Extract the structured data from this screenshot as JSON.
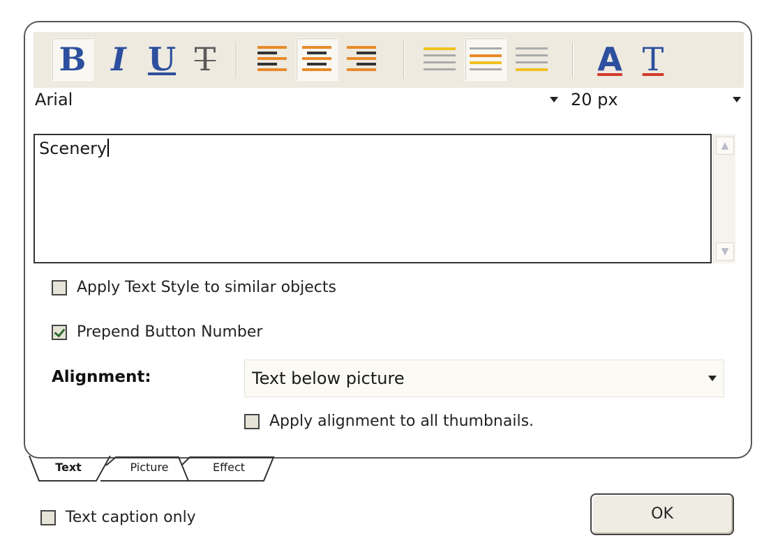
{
  "toolbar": {
    "format_buttons": [
      {
        "name": "bold",
        "glyph": "B",
        "selected": true
      },
      {
        "name": "italic",
        "glyph": "I",
        "selected": false
      },
      {
        "name": "underline",
        "glyph": "U",
        "selected": false
      },
      {
        "name": "strikethrough",
        "glyph": "T",
        "selected": false
      }
    ],
    "align_buttons": [
      {
        "name": "align-left-icon",
        "selected": false
      },
      {
        "name": "align-center-icon",
        "selected": true
      },
      {
        "name": "align-right-icon",
        "selected": false
      }
    ],
    "valign_buttons": [
      {
        "name": "valign-top-icon",
        "selected": false
      },
      {
        "name": "valign-middle-icon",
        "selected": true
      },
      {
        "name": "valign-bottom-icon",
        "selected": false
      }
    ],
    "color_buttons": [
      {
        "name": "text-color-icon",
        "glyph": "A"
      },
      {
        "name": "text-background-color-icon",
        "glyph": "T"
      }
    ],
    "font_family": "Arial",
    "font_size": "20 px"
  },
  "editor": {
    "value": "Scenery"
  },
  "options": {
    "apply_text_style": {
      "label": "Apply Text Style to similar objects",
      "checked": false
    },
    "prepend_button_number": {
      "label": "Prepend Button Number",
      "checked": true
    }
  },
  "alignment": {
    "label": "Alignment:",
    "value": "Text below picture",
    "apply_all": {
      "label": "Apply alignment to all thumbnails.",
      "checked": false
    }
  },
  "tabs": [
    {
      "label": "Text",
      "active": true
    },
    {
      "label": "Picture",
      "active": false
    },
    {
      "label": "Effect",
      "active": false
    }
  ],
  "footer": {
    "text_caption_only": {
      "label": "Text caption only",
      "checked": false
    },
    "ok_label": "OK"
  },
  "colors": {
    "toolbar_bg": "#eeeae0",
    "icon_blue": "#2d4f9e",
    "accent_orange": "#e98a2a",
    "accent_yellow": "#f0c020",
    "underline_red": "#d23a2a"
  }
}
